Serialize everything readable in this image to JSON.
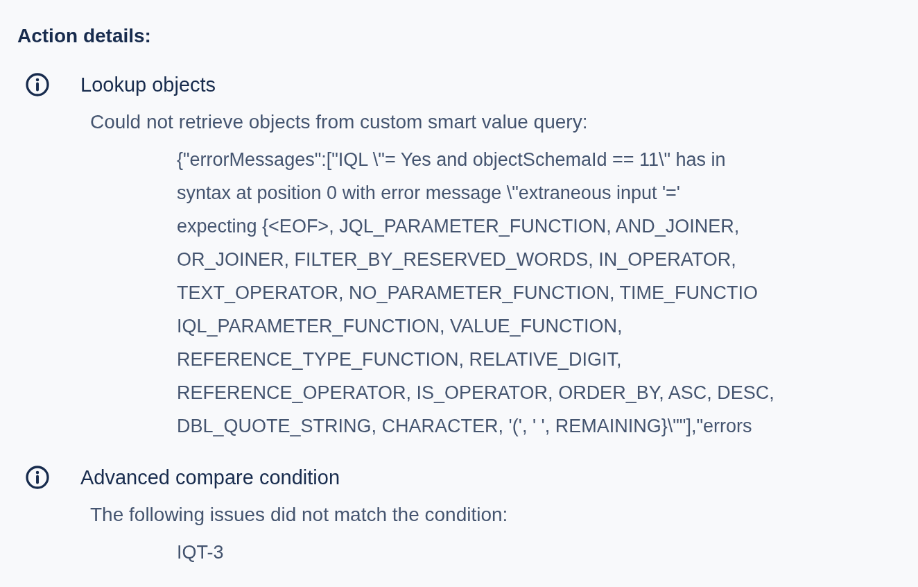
{
  "heading": "Action details:",
  "items": [
    {
      "title": "Lookup objects",
      "description": "Could not retrieve objects from custom smart value query:",
      "detail_lines": [
        "{\"errorMessages\":[\"IQL \\\"= Yes and objectSchemaId == 11\\\" has in",
        "syntax at position 0 with error message \\\"extraneous input '='",
        "expecting {<EOF>, JQL_PARAMETER_FUNCTION, AND_JOINER,",
        "OR_JOINER, FILTER_BY_RESERVED_WORDS, IN_OPERATOR,",
        "TEXT_OPERATOR, NO_PARAMETER_FUNCTION, TIME_FUNCTIO",
        "IQL_PARAMETER_FUNCTION, VALUE_FUNCTION,",
        "REFERENCE_TYPE_FUNCTION, RELATIVE_DIGIT,",
        "REFERENCE_OPERATOR, IS_OPERATOR, ORDER_BY, ASC, DESC,",
        "DBL_QUOTE_STRING, CHARACTER, '(', ' ', REMAINING}\\\"\"],\"errors"
      ]
    },
    {
      "title": "Advanced compare condition",
      "description": "The following issues did not match the condition:",
      "detail_lines": [
        "IQT-3"
      ]
    }
  ]
}
